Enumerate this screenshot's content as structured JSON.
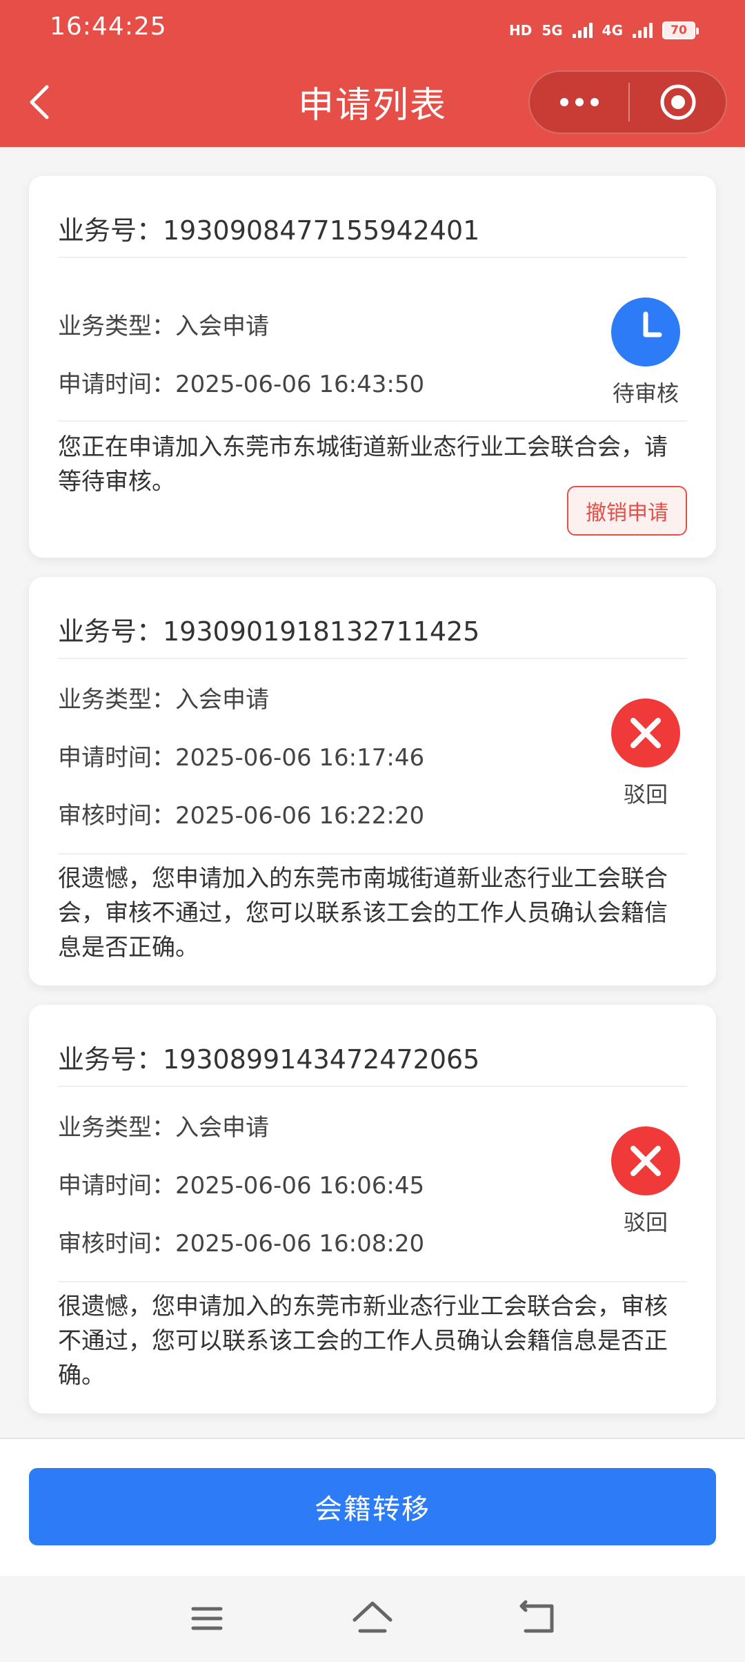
{
  "status_bar": {
    "time": "16:44:25",
    "hd_label": "HD",
    "net1": "5G",
    "net2": "4G",
    "battery": "70"
  },
  "header": {
    "title": "申请列表",
    "back_icon": "chevron-left-icon",
    "more_icon": "more-dots-icon",
    "close_icon": "target-close-icon"
  },
  "cards": [
    {
      "business_no": "业务号：1930908477155942401",
      "type": "业务类型：入会申请",
      "apply_time": "申请时间：2025-06-06 16:43:50",
      "status": "待审核",
      "status_color": "#2b7cf6",
      "message": "您正在申请加入东莞市东城街道新业态行业工会联合会，请等待审核。",
      "cancel_label": "撤销申请"
    },
    {
      "business_no": "业务号：1930901918132711425",
      "type": "业务类型：入会申请",
      "apply_time": "申请时间：2025-06-06 16:17:46",
      "review_time": "审核时间：2025-06-06 16:22:20",
      "status": "驳回",
      "status_color": "#f03a3a",
      "message": "很遗憾，您申请加入的东莞市南城街道新业态行业工会联合会，审核不通过，您可以联系该工会的工作人员确认会籍信息是否正确。"
    },
    {
      "business_no": "业务号：1930899143472472065",
      "type": "业务类型：入会申请",
      "apply_time": "申请时间：2025-06-06 16:06:45",
      "review_time": "审核时间：2025-06-06 16:08:20",
      "status": "驳回",
      "status_color": "#f03a3a",
      "message": "很遗憾，您申请加入的东莞市新业态行业工会联合会，审核不通过，您可以联系该工会的工作人员确认会籍信息是否正确。"
    }
  ],
  "bottom": {
    "transfer_label": "会籍转移"
  },
  "system_nav": {
    "menu_icon": "menu-icon",
    "home_icon": "home-icon",
    "back_icon": "back-icon"
  },
  "colors": {
    "header_red": "#e64f47",
    "primary_blue": "#2b7cf6"
  }
}
